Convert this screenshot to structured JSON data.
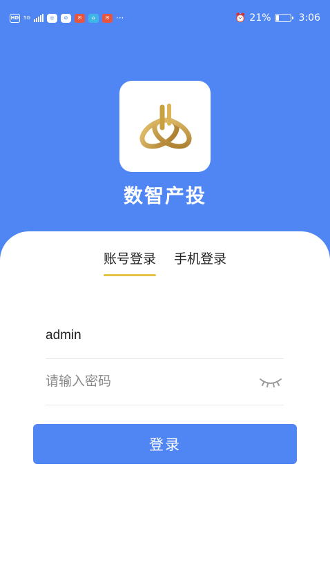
{
  "status_bar": {
    "hd": "HD",
    "network": "5G",
    "ellipsis": "···",
    "battery_percent": "21%",
    "time": "3:06",
    "battery_level": 0.21
  },
  "app": {
    "name": "数智产投"
  },
  "tabs": [
    {
      "label": "账号登录",
      "active": true
    },
    {
      "label": "手机登录",
      "active": false
    }
  ],
  "form": {
    "username": "admin",
    "password_placeholder": "请输入密码"
  },
  "login_button": "登录",
  "colors": {
    "primary": "#4f86f4",
    "tab_underline": "#e5c244",
    "logo_gold": "#c9a040"
  }
}
